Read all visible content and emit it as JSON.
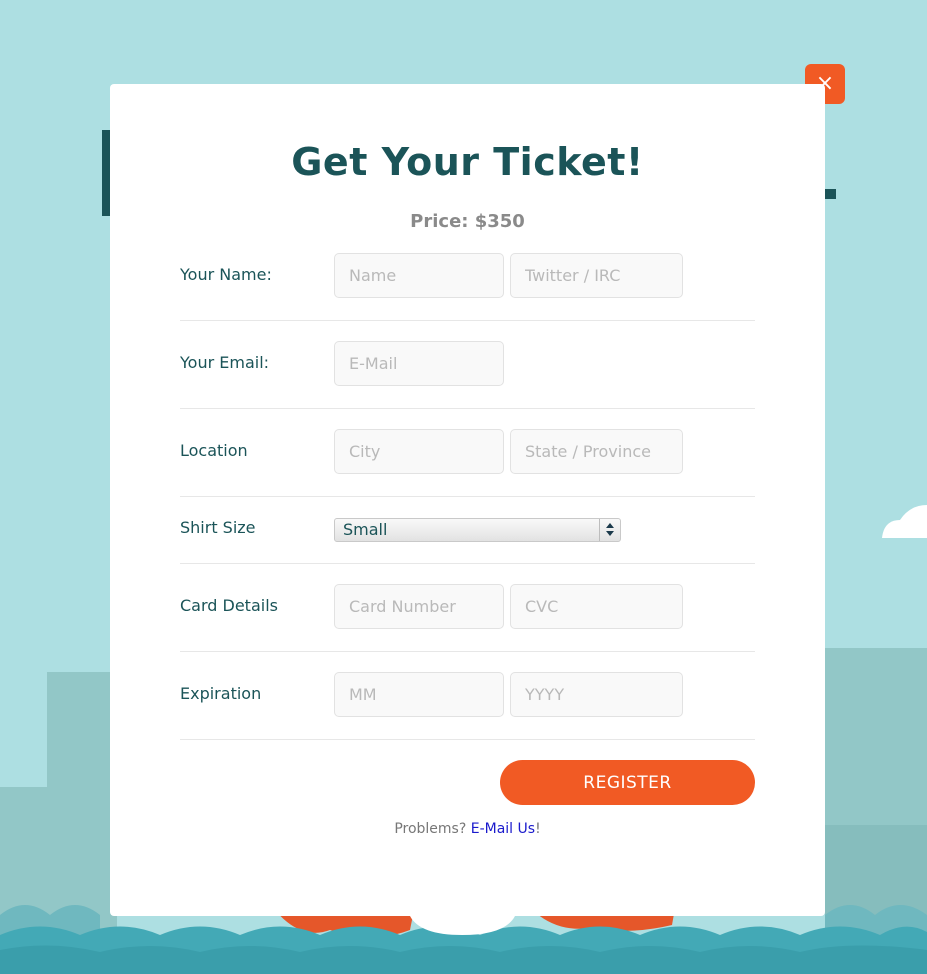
{
  "modal": {
    "close_label": "×",
    "title": "Get Your Ticket!",
    "price": "Price: $350"
  },
  "form": {
    "name": {
      "label": "Your Name:",
      "name_placeholder": "Name",
      "twitter_placeholder": "Twitter / IRC"
    },
    "email": {
      "label": "Your Email:",
      "email_placeholder": "E-Mail"
    },
    "location": {
      "label": "Location",
      "city_placeholder": "City",
      "state_placeholder": "State / Province"
    },
    "shirt": {
      "label": "Shirt Size",
      "selected": "Small"
    },
    "card": {
      "label": "Card Details",
      "number_placeholder": "Card Number",
      "cvc_placeholder": "CVC"
    },
    "expiration": {
      "label": "Expiration",
      "month_placeholder": "MM",
      "year_placeholder": "YYYY"
    },
    "register_label": "REGISTER"
  },
  "footer": {
    "problems_text": "Problems? ",
    "email_link": "E-Mail Us",
    "suffix": "!"
  },
  "colors": {
    "sky": "#addfe2",
    "accent": "#f15a24",
    "title": "#1b5458",
    "water": "#43a9b6"
  }
}
